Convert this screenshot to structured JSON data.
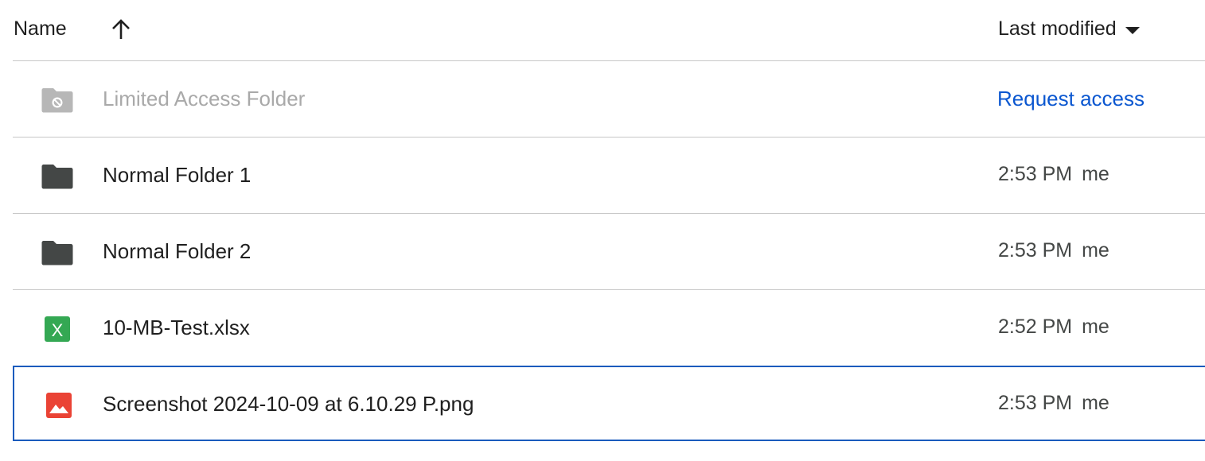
{
  "header": {
    "name_label": "Name",
    "modified_label": "Last modified",
    "sort_icon": "arrow-up-icon",
    "dropdown_icon": "caret-down-icon"
  },
  "colors": {
    "accent": "#0b57d0",
    "selection_border": "#1a5bbd",
    "folder": "#444746",
    "folder_disabled": "#b7b7b7",
    "sheets_green": "#34a853",
    "image_red": "#ea4335",
    "divider": "#c7c7c7"
  },
  "rows": [
    {
      "name": "Limited Access Folder",
      "icon": "restricted-folder-icon",
      "action": "Request access",
      "disabled": true
    },
    {
      "name": "Normal Folder 1",
      "icon": "folder-icon",
      "time": "2:53 PM",
      "owner": "me"
    },
    {
      "name": "Normal Folder 2",
      "icon": "folder-icon",
      "time": "2:53 PM",
      "owner": "me"
    },
    {
      "name": "10-MB-Test.xlsx",
      "icon": "sheets-icon",
      "icon_letter": "X",
      "time": "2:52 PM",
      "owner": "me"
    },
    {
      "name": "Screenshot 2024-10-09 at 6.10.29 P.png",
      "icon": "image-icon",
      "time": "2:53 PM",
      "owner": "me",
      "selected": true
    }
  ]
}
